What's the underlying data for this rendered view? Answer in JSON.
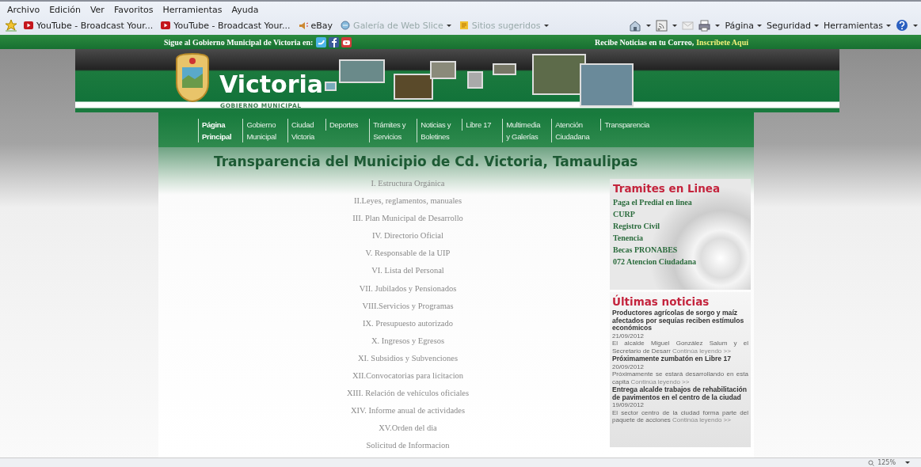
{
  "menu_bar": [
    "Archivo",
    "Edición",
    "Ver",
    "Favoritos",
    "Herramientas",
    "Ayuda"
  ],
  "favorites_bar": [
    {
      "label": "YouTube - Broadcast Your...",
      "kind": "video",
      "disabled": false,
      "dropdown": false
    },
    {
      "label": "YouTube - Broadcast Your...",
      "kind": "video",
      "disabled": false,
      "dropdown": false
    },
    {
      "label": "eBay",
      "kind": "shop",
      "disabled": false,
      "dropdown": false
    },
    {
      "label": "Galería de Web Slice",
      "kind": "slice",
      "disabled": true,
      "dropdown": true
    },
    {
      "label": "Sitios sugeridos",
      "kind": "suggest",
      "disabled": true,
      "dropdown": true
    }
  ],
  "command_bar": [
    {
      "kind": "home"
    },
    {
      "kind": "feed"
    },
    {
      "kind": "mail"
    },
    {
      "kind": "print"
    },
    {
      "kind": "text",
      "label": "Página"
    },
    {
      "kind": "text",
      "label": "Seguridad"
    },
    {
      "kind": "text",
      "label": "Herramientas"
    },
    {
      "kind": "help"
    }
  ],
  "social_bar": {
    "follow_text": "Sigue al Gobierno Municipal de Victoria en:",
    "news_text": "Recibe Noticias en tu Correo,",
    "subscribe_link": "Inscríbete Aquí"
  },
  "header": {
    "title": "Victoria",
    "subtitle": "GOBIERNO MUNICIPAL"
  },
  "nav": [
    {
      "lines": [
        "Página",
        "Principal"
      ],
      "selected": true
    },
    {
      "lines": [
        "Gobierno",
        "Municipal"
      ],
      "selected": false
    },
    {
      "lines": [
        "Ciudad",
        "Victoria"
      ],
      "selected": false
    },
    {
      "lines": [
        "Deportes"
      ],
      "selected": false
    },
    {
      "lines": [
        "Trámites y",
        "Servicios"
      ],
      "selected": false
    },
    {
      "lines": [
        "Noticias y",
        "Boletines"
      ],
      "selected": false
    },
    {
      "lines": [
        "Libre 17"
      ],
      "selected": false
    },
    {
      "lines": [
        "Multimedia",
        "y Galerías"
      ],
      "selected": false
    },
    {
      "lines": [
        "Atención",
        "Ciudadana"
      ],
      "selected": false
    },
    {
      "lines": [
        "Transparencia"
      ],
      "selected": false
    }
  ],
  "page_title": "Transparencia del Municipio de Cd. Victoria, Tamaulipas",
  "transparency_links": [
    "I. Estructura Orgánica",
    "II.Leyes, reglamentos, manuales",
    "III. Plan Municipal de Desarrollo",
    "IV. Directorio Oficial",
    "V. Responsable de la UIP",
    "VI. Lista del Personal",
    "VII. Jubilados y Pensionados",
    "VIII.Servicios y Programas",
    "IX. Presupuesto autorizado",
    "X. Ingresos y Egresos",
    "XI. Subsidios y Subvenciones",
    "XII.Convocatorias para licitacion",
    "XIII. Relación de vehículos oficiales",
    "XIV. Informe anual de actividades",
    "XV.Orden del dia",
    "Solicitud de Informacion"
  ],
  "tramites": {
    "heading": "Tramites en Linea",
    "links": [
      "Paga el Predial en linea",
      "CURP",
      "Registro Civil",
      "Tenencia",
      "Becas PRONABES",
      "072 Atencion Ciudadana"
    ]
  },
  "news": {
    "heading": "Últimas noticias",
    "items": [
      {
        "title": "Productores agrícolas de sorgo y maíz afectados por sequías reciben estímulos económicos",
        "date": "21/09/2012",
        "summary": "El alcalde Miguel González Salum y el Secretario de Desarr",
        "more": "Continúa leyendo >>"
      },
      {
        "title": "Próximamente zumbatón en Libre 17",
        "date": "20/09/2012",
        "summary": "Próximamente se estará desarrollando en esta capita",
        "more": "Continúa leyendo >>"
      },
      {
        "title": "Entrega alcalde trabajos de rehabilitación de pavimentos en el centro de la ciudad",
        "date": "19/09/2012",
        "summary": "El sector centro de la ciudad forma parte del paquete de acciones",
        "more": "Continúa leyendo >>"
      }
    ]
  },
  "status_bar": {
    "zoom": "125%"
  }
}
